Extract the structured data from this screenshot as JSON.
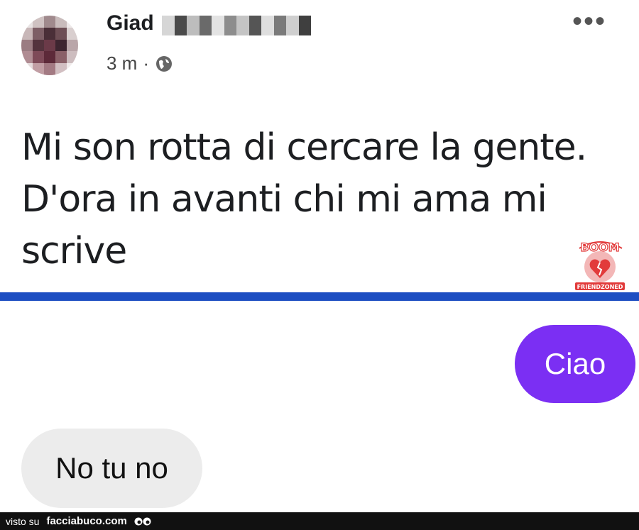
{
  "post": {
    "author_name": "Giad",
    "timestamp": "3 m",
    "separator": "·",
    "privacy_icon": "globe-icon",
    "more_icon": "more-options-icon",
    "more_symbol": "•••",
    "text_line1": "Mi son rotta di cercare la gente.",
    "text_line2": "D'ora in avanti chi mi ama mi",
    "text_line3": "scrive"
  },
  "watermark": {
    "top_text": "BOOM",
    "bottom_text": "FRIENDZONED",
    "color": "#e23b3b"
  },
  "chat": {
    "outgoing_message": "Ciao",
    "incoming_message": "No tu no",
    "outgoing_color": "#7b2ff3",
    "incoming_color": "#ececec"
  },
  "divider_color": "#1d4ec2",
  "footer": {
    "prefix": "visto su",
    "site": "facciabuco.com",
    "icon": "eyes-icon"
  }
}
